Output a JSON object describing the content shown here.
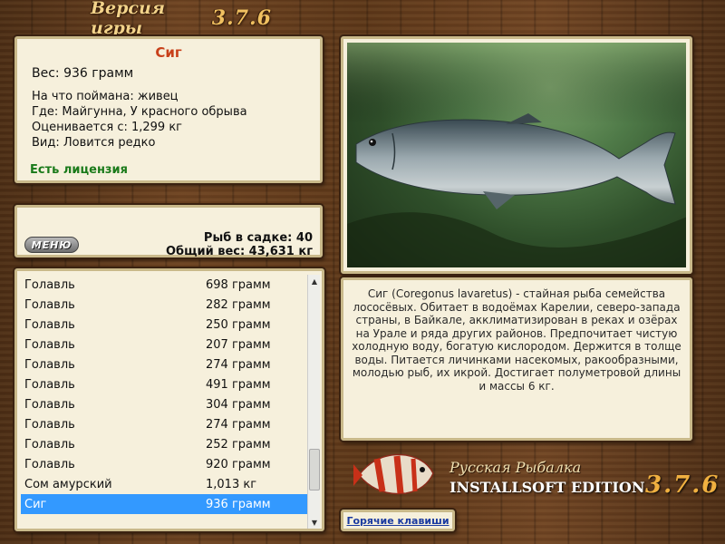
{
  "header": {
    "title": "Версия игры",
    "version": "3.7.6"
  },
  "fish": {
    "name": "Сиг",
    "weight": "Вес: 936 грамм",
    "bait": "На что поймана: живец",
    "location": "Где: Майгунна, У красного обрыва",
    "valued": "Оценивается с: 1,299 кг",
    "type": "Вид: Ловится редко",
    "license": "Есть лицензия"
  },
  "stats": {
    "menu_label": "МЕНЮ",
    "count": "Рыб в садке: 40",
    "total": "Общий вес: 43,631 кг"
  },
  "catch_list": [
    {
      "name": "Голавль",
      "weight": "698 грамм"
    },
    {
      "name": "Голавль",
      "weight": "282 грамм"
    },
    {
      "name": "Голавль",
      "weight": "250 грамм"
    },
    {
      "name": "Голавль",
      "weight": "207 грамм"
    },
    {
      "name": "Голавль",
      "weight": "274 грамм"
    },
    {
      "name": "Голавль",
      "weight": "491 грамм"
    },
    {
      "name": "Голавль",
      "weight": "304 грамм"
    },
    {
      "name": "Голавль",
      "weight": "274 грамм"
    },
    {
      "name": "Голавль",
      "weight": "252 грамм"
    },
    {
      "name": "Голавль",
      "weight": "920 грамм"
    },
    {
      "name": "Сом амурский",
      "weight": "1,013 кг"
    },
    {
      "name": "Сиг",
      "weight": "936 грамм",
      "selected": true
    }
  ],
  "description": "Сиг (Coregonus lavaretus) - стайная рыба семейства лососёвых. Обитает в водоёмах Карелии, северо-запада страны, в Байкале, акклиматизирован в реках и озёрах на Урале и ряда других районов. Предпочитает чистую холодную воду, богатую кислородом. Держится в толще воды. Питается личинками насекомых, ракообразными, молодью рыб, их икрой. Достигает полуметровой длины и массы 6 кг.",
  "hotkeys_label": "Горячие клавиши",
  "logo": {
    "title": "Русская Рыбалка",
    "edition": "INSTALLSOFT EDITION",
    "version": "3.7.6"
  },
  "colors": {
    "fish_name": "#c8401a",
    "license": "#1a7a1a",
    "selection": "#3399ff",
    "link": "#1a3aa0"
  }
}
